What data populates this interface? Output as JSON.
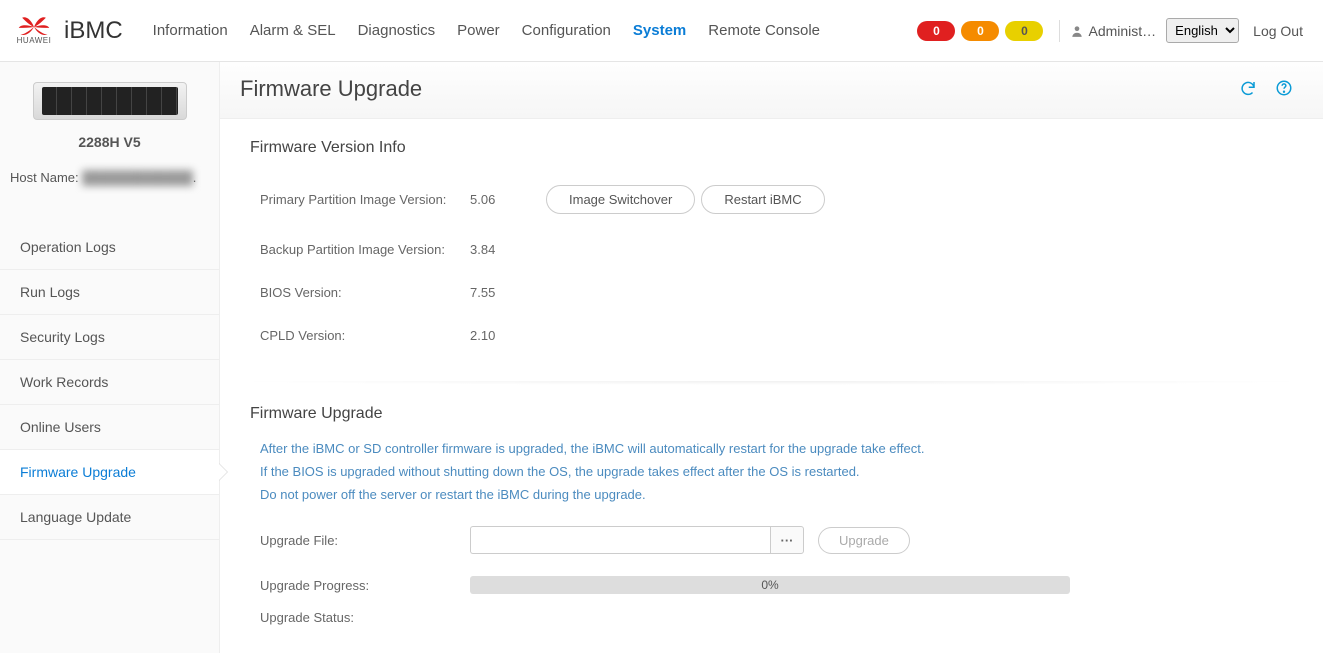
{
  "brand": {
    "name": "HUAWEI",
    "product": "iBMC"
  },
  "topnav": {
    "items": [
      "Information",
      "Alarm & SEL",
      "Diagnostics",
      "Power",
      "Configuration",
      "System",
      "Remote Console"
    ],
    "active_index": 5
  },
  "badges": {
    "red": "0",
    "orange": "0",
    "yellow": "0"
  },
  "user": "Administ…",
  "language": "English",
  "logout": "Log Out",
  "sidebar": {
    "model": "2288H V5",
    "hostname_label": "Host Name:",
    "hostname_value": "████████████",
    "items": [
      "Operation Logs",
      "Run Logs",
      "Security Logs",
      "Work Records",
      "Online Users",
      "Firmware Upgrade",
      "Language Update"
    ],
    "active_index": 5
  },
  "page": {
    "title": "Firmware Upgrade",
    "section1_title": "Firmware Version Info",
    "primary_label": "Primary Partition Image Version:",
    "primary_val": "5.06",
    "switchover_btn": "Image Switchover",
    "restart_btn": "Restart iBMC",
    "backup_label": "Backup Partition Image Version:",
    "backup_val": "3.84",
    "bios_label": "BIOS Version:",
    "bios_val": "7.55",
    "cpld_label": "CPLD Version:",
    "cpld_val": "2.10",
    "section2_title": "Firmware Upgrade",
    "note1": "After the iBMC or SD controller firmware is upgraded, the iBMC will automatically restart for the upgrade take effect.",
    "note2": "If the BIOS is upgraded without shutting down the OS, the upgrade takes effect after the OS is restarted.",
    "note3": "Do not power off the server or restart the iBMC during the upgrade.",
    "file_label": "Upgrade File:",
    "file_val": "",
    "browse_glyph": "···",
    "upgrade_btn": "Upgrade",
    "progress_label": "Upgrade Progress:",
    "progress_text": "0%",
    "status_label": "Upgrade Status:",
    "status_val": ""
  }
}
